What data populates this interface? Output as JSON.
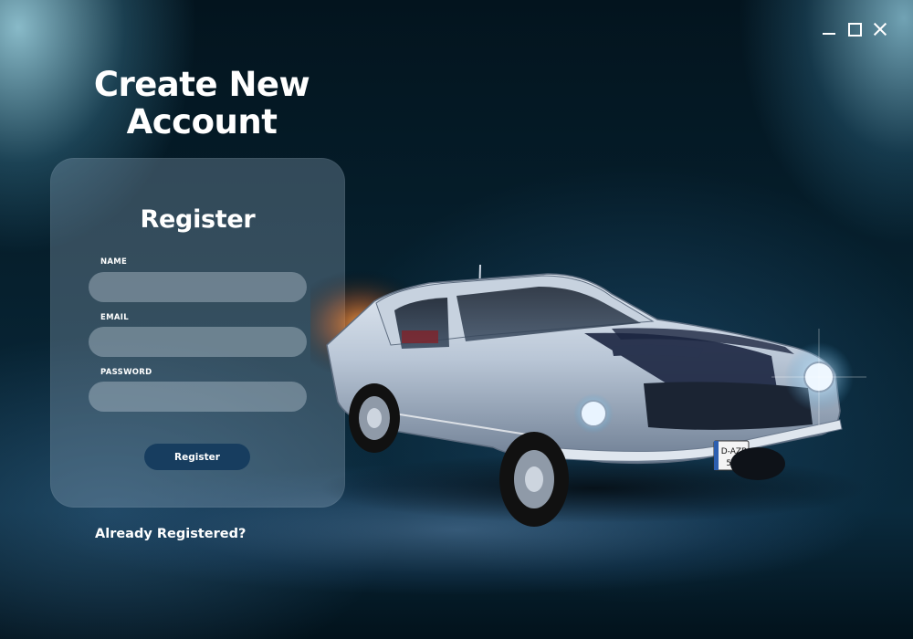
{
  "window": {
    "minimize_icon": "minimize-icon",
    "maximize_icon": "maximize-icon",
    "close_icon": "close-icon"
  },
  "page": {
    "title_line1": "Create New",
    "title_line2": "Account"
  },
  "form": {
    "title": "Register",
    "name_label": "NAME",
    "name_value": "",
    "email_label": "EMAIL",
    "email_value": "",
    "password_label": "PASSWORD",
    "password_value": "",
    "submit_label": "Register"
  },
  "footer": {
    "login_link": "Already Registered?"
  },
  "car": {
    "plate_line1": "D-AZB",
    "plate_line2": "530"
  },
  "colors": {
    "accent": "#173d5f",
    "background": "#06202e"
  }
}
